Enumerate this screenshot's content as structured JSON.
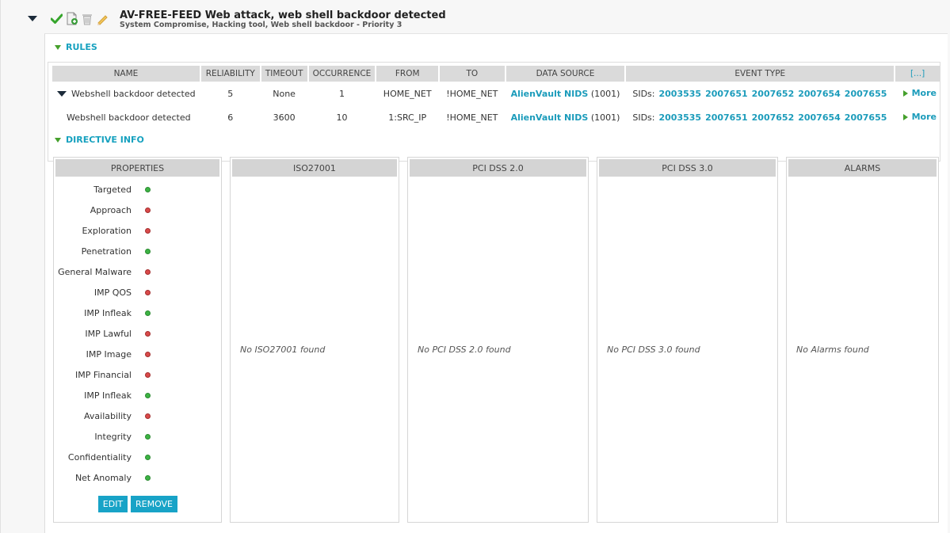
{
  "directive": {
    "title": "AV-FREE-FEED Web attack, web shell backdoor detected",
    "subtitle": "System Compromise, Hacking tool, Web shell backdoor - Priority 3"
  },
  "icons": [
    "check-icon",
    "export-document-icon",
    "trash-icon",
    "pencil-icon"
  ],
  "rules": {
    "section_label": "RULES",
    "columns": [
      "NAME",
      "RELIABILITY",
      "TIMEOUT",
      "OCCURRENCE",
      "FROM",
      "TO",
      "DATA SOURCE",
      "EVENT TYPE",
      "[...]"
    ],
    "rows": [
      {
        "name": "Webshell backdoor detected",
        "reliability": "5",
        "timeout": "None",
        "occurrence": "1",
        "from": "HOME_NET",
        "to": "!HOME_NET",
        "ds_name": "AlienVault NIDS",
        "ds_id": "(1001)",
        "sids_label": "SIDs:",
        "sids": [
          "2003535",
          "2007651",
          "2007652",
          "2007654",
          "2007655"
        ],
        "more": "More"
      },
      {
        "name": "Webshell backdoor detected",
        "reliability": "6",
        "timeout": "3600",
        "occurrence": "10",
        "from": "1:SRC_IP",
        "to": "!HOME_NET",
        "ds_name": "AlienVault NIDS",
        "ds_id": "(1001)",
        "sids_label": "SIDs:",
        "sids": [
          "2003535",
          "2007651",
          "2007652",
          "2007654",
          "2007655"
        ],
        "more": "More"
      }
    ]
  },
  "directive_info": {
    "section_label": "DIRECTIVE INFO",
    "properties": {
      "header": "PROPERTIES",
      "items": [
        {
          "label": "Targeted",
          "status": "ok"
        },
        {
          "label": "Approach",
          "status": "no"
        },
        {
          "label": "Exploration",
          "status": "no"
        },
        {
          "label": "Penetration",
          "status": "ok"
        },
        {
          "label": "General Malware",
          "status": "no"
        },
        {
          "label": "IMP QOS",
          "status": "no"
        },
        {
          "label": "IMP Infleak",
          "status": "ok"
        },
        {
          "label": "IMP Lawful",
          "status": "no"
        },
        {
          "label": "IMP Image",
          "status": "no"
        },
        {
          "label": "IMP Financial",
          "status": "no"
        },
        {
          "label": "IMP Infleak",
          "status": "ok"
        },
        {
          "label": "Availability",
          "status": "no"
        },
        {
          "label": "Integrity",
          "status": "ok"
        },
        {
          "label": "Confidentiality",
          "status": "ok"
        },
        {
          "label": "Net Anomaly",
          "status": "ok"
        }
      ],
      "edit_label": "EDIT",
      "remove_label": "REMOVE"
    },
    "iso": {
      "header": "ISO27001",
      "empty": "No ISO27001 found"
    },
    "pci2": {
      "header": "PCI DSS 2.0",
      "empty": "No PCI DSS 2.0 found"
    },
    "pci3": {
      "header": "PCI DSS 3.0",
      "empty": "No PCI DSS 3.0 found"
    },
    "alarms": {
      "header": "ALARMS",
      "empty": "No Alarms found"
    }
  },
  "colors": {
    "accent": "#1c9cbb",
    "ok": "#3db344",
    "no": "#d94a4a",
    "section_arrow": "#45a02c"
  }
}
